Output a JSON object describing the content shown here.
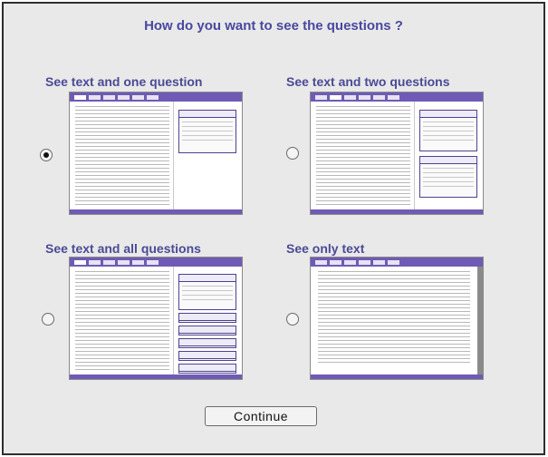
{
  "heading": "How do you want to see the questions ?",
  "options": [
    {
      "label": "See text and one question",
      "selected": true
    },
    {
      "label": "See text and two questions",
      "selected": false
    },
    {
      "label": "See text and all questions",
      "selected": false
    },
    {
      "label": "See only text",
      "selected": false
    }
  ],
  "continue_label": "Continue",
  "colors": {
    "heading": "#4848a0",
    "preview_bar": "#6f5bb5",
    "background": "#e9e9e9"
  }
}
